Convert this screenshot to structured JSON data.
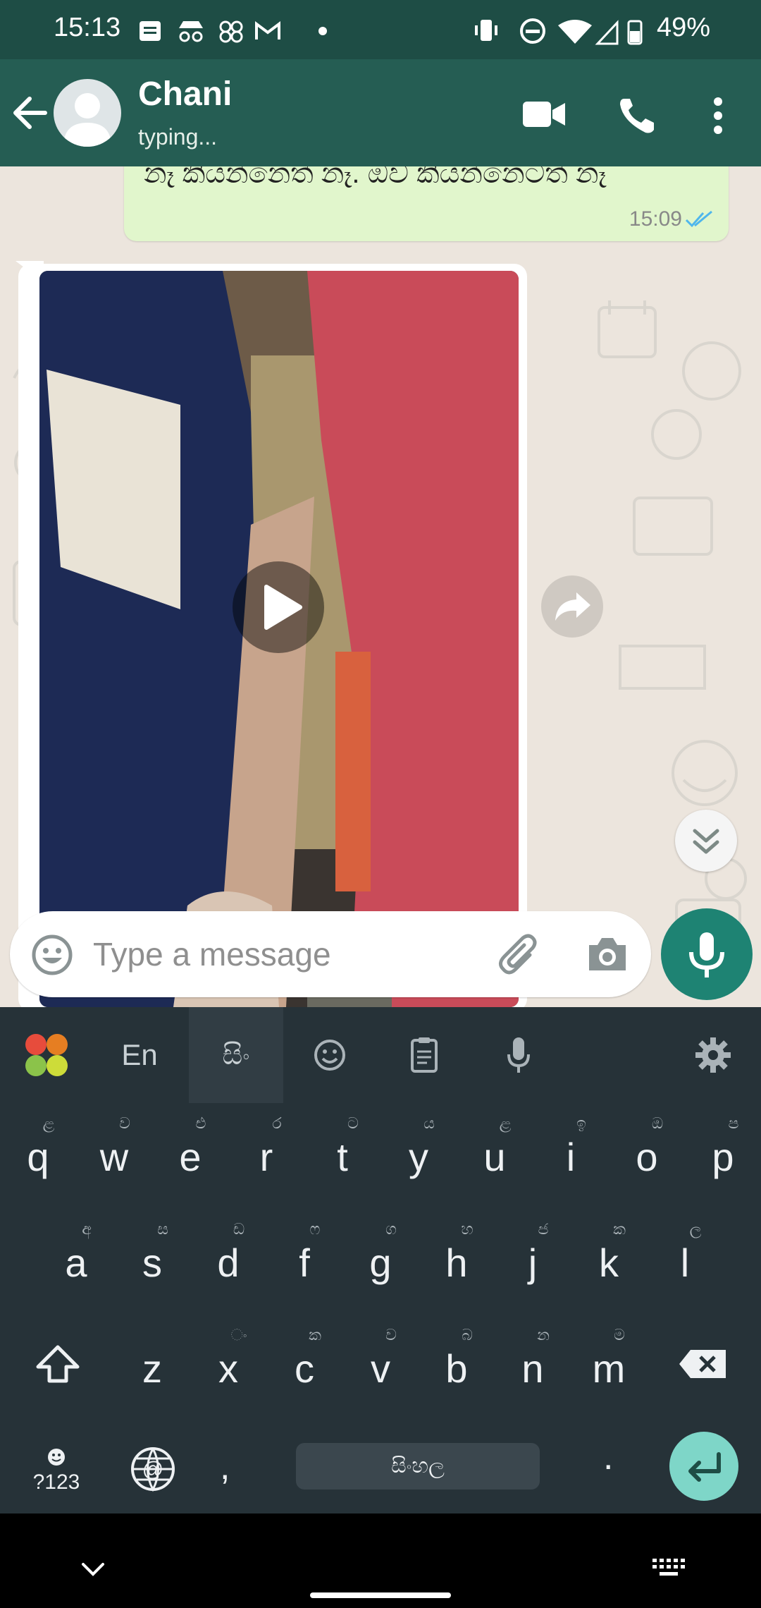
{
  "status_bar": {
    "time": "15:13",
    "battery": "49%",
    "icons": [
      "notification-icon",
      "incognito-icon",
      "app-icon",
      "gmail-icon",
      "dot-icon",
      "vibrate-icon",
      "dnd-icon",
      "wifi-icon",
      "signal-icon",
      "battery-icon"
    ]
  },
  "header": {
    "contact_name": "Chani",
    "status": "typing..."
  },
  "messages": {
    "outgoing_text": "නෑ කියන්නෙත් නෑ. ඔව කියන්නෙටත් නෑ",
    "outgoing_time": "15:09"
  },
  "composer": {
    "placeholder": "Type a message"
  },
  "keyboard": {
    "toolbar": {
      "lang_en": "En",
      "lang_si": "සිං"
    },
    "row1": [
      {
        "key": "q",
        "hint": "ළ"
      },
      {
        "key": "w",
        "hint": "ව"
      },
      {
        "key": "e",
        "hint": "එ"
      },
      {
        "key": "r",
        "hint": "ර"
      },
      {
        "key": "t",
        "hint": "ට"
      },
      {
        "key": "y",
        "hint": "ය"
      },
      {
        "key": "u",
        "hint": "ළ"
      },
      {
        "key": "i",
        "hint": "ඉ"
      },
      {
        "key": "o",
        "hint": "ඔ"
      },
      {
        "key": "p",
        "hint": "ප"
      }
    ],
    "row2": [
      {
        "key": "a",
        "hint": "අ"
      },
      {
        "key": "s",
        "hint": "ස"
      },
      {
        "key": "d",
        "hint": "ඩ"
      },
      {
        "key": "f",
        "hint": "ෆ"
      },
      {
        "key": "g",
        "hint": "ග"
      },
      {
        "key": "h",
        "hint": "හ"
      },
      {
        "key": "j",
        "hint": "ජ"
      },
      {
        "key": "k",
        "hint": "ක"
      },
      {
        "key": "l",
        "hint": "ල"
      }
    ],
    "row3": [
      {
        "key": "z",
        "hint": ""
      },
      {
        "key": "x",
        "hint": "ං"
      },
      {
        "key": "c",
        "hint": "ක"
      },
      {
        "key": "v",
        "hint": "ව"
      },
      {
        "key": "b",
        "hint": "බ"
      },
      {
        "key": "n",
        "hint": "න"
      },
      {
        "key": "m",
        "hint": "ම"
      }
    ],
    "sym_key": "?123",
    "comma": ",",
    "period": ".",
    "space_label": "සිංහල"
  }
}
